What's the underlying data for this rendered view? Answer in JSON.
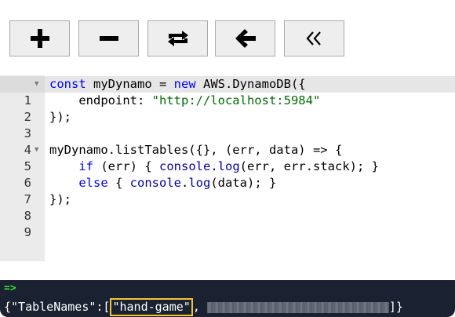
{
  "toolbar": {
    "buttons": [
      {
        "id": "add",
        "icon": "plus-icon"
      },
      {
        "id": "remove",
        "icon": "minus-icon"
      },
      {
        "id": "repeat",
        "icon": "repeat-icon"
      },
      {
        "id": "back",
        "icon": "arrow-left-icon"
      },
      {
        "id": "first",
        "icon": "double-chevron-left-icon"
      }
    ]
  },
  "editor": {
    "line_numbers": [
      "1",
      "2",
      "3",
      "4",
      "5",
      "6",
      "7",
      "8",
      "9"
    ],
    "fold_markers": {
      "1": "▼",
      "5": "▼"
    },
    "lines": {
      "l1": {
        "kw1": "const",
        "t1": " myDynamo = ",
        "kw2": "new",
        "t2": " AWS.DynamoDB({"
      },
      "l2": {
        "t1": "    endpoint: ",
        "str": "\"http://localhost:5984\""
      },
      "l3": {
        "t1": "});"
      },
      "l4": {
        "t1": ""
      },
      "l5": {
        "t1": "myDynamo.listTables({}, (err, data) ",
        "op": "=>",
        "t2": " {"
      },
      "l6": {
        "t1": "    ",
        "kw1": "if",
        "t2": " (err) { ",
        "fn1": "console",
        "t3": ".",
        "fn2": "log",
        "t4": "(err, err.stack); }"
      },
      "l7": {
        "t1": "    ",
        "kw1": "else",
        "t2": " { ",
        "fn1": "console",
        "t3": ".",
        "fn2": "log",
        "t4": "(data); }"
      },
      "l8": {
        "t1": "});"
      },
      "l9": {
        "t1": ""
      }
    }
  },
  "console": {
    "prompt": "=>",
    "output_prefix": "{\"TableNames\":[",
    "highlighted": "\"hand-game\"",
    "separator": ",",
    "suffix": "]}"
  },
  "colors": {
    "keyword": "#0000ff",
    "string": "#036a07",
    "console_bg": "#1a2130",
    "prompt": "#39e23a",
    "highlight_border": "#f2c33a"
  }
}
